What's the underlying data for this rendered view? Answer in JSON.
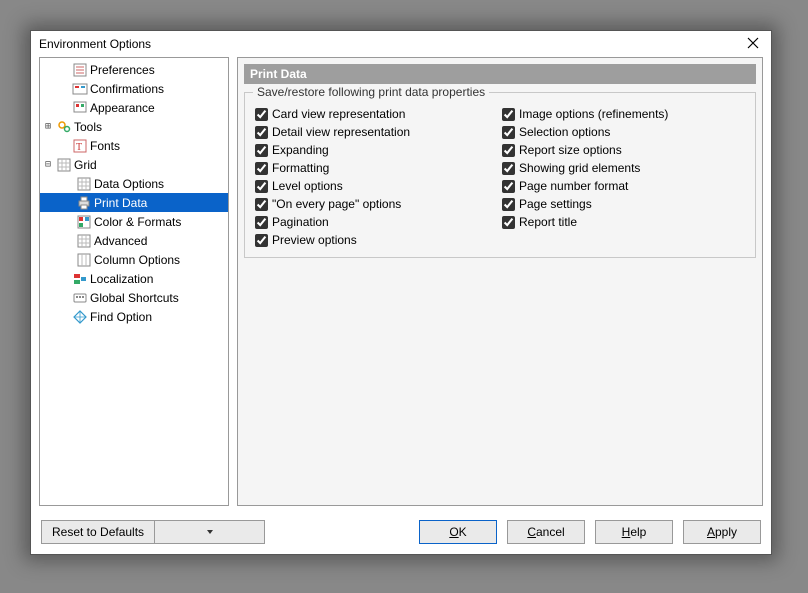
{
  "window": {
    "title": "Environment Options"
  },
  "tree": {
    "preferences": "Preferences",
    "confirmations": "Confirmations",
    "appearance": "Appearance",
    "tools": "Tools",
    "fonts": "Fonts",
    "grid": "Grid",
    "data_options": "Data Options",
    "print_data": "Print Data",
    "color_formats": "Color & Formats",
    "advanced": "Advanced",
    "column_options": "Column Options",
    "localization": "Localization",
    "global_shortcuts": "Global Shortcuts",
    "find_option": "Find Option"
  },
  "panel": {
    "title": "Print Data",
    "group_label": "Save/restore following print data properties",
    "col1": {
      "card_view": "Card view representation",
      "detail_view": "Detail view representation",
      "expanding": "Expanding",
      "formatting": "Formatting",
      "level_options": "Level options",
      "on_every_page": "\"On every page\" options",
      "pagination": "Pagination",
      "preview_options": "Preview options"
    },
    "col2": {
      "image_options": "Image options (refinements)",
      "selection_options": "Selection options",
      "report_size": "Report size options",
      "showing_grid": "Showing grid elements",
      "page_number_format": "Page number format",
      "page_settings": "Page settings",
      "report_title": "Report title"
    }
  },
  "buttons": {
    "reset": "Reset to Defaults",
    "ok": "OK",
    "cancel": "Cancel",
    "help": "Help",
    "apply": "Apply"
  },
  "check_states": {
    "card_view": true,
    "detail_view": true,
    "expanding": true,
    "formatting": true,
    "level_options": true,
    "on_every_page": true,
    "pagination": true,
    "preview_options": true,
    "image_options": true,
    "selection_options": true,
    "report_size": true,
    "showing_grid": true,
    "page_number_format": true,
    "page_settings": true,
    "report_title": true
  }
}
